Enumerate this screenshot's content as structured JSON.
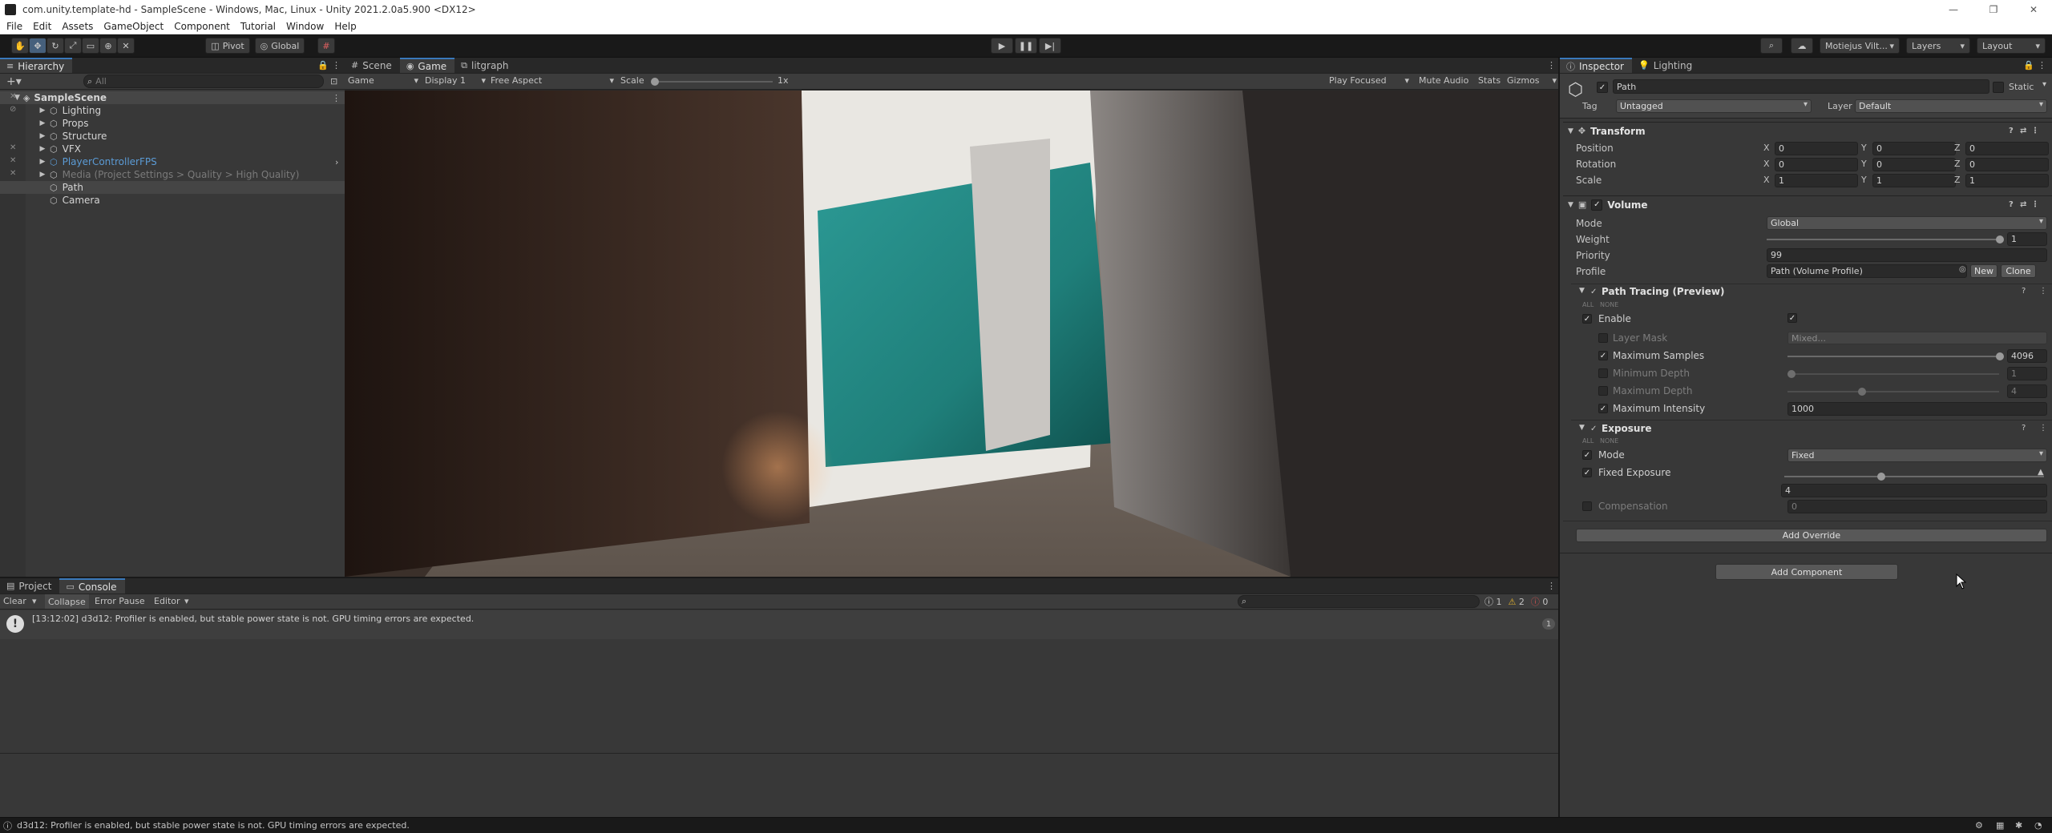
{
  "window": {
    "title": "com.unity.template-hd - SampleScene - Windows, Mac, Linux - Unity 2021.2.0a5.900 <DX12>",
    "minimize": "—",
    "maximize": "❐",
    "close": "✕"
  },
  "menu": [
    "File",
    "Edit",
    "Assets",
    "GameObject",
    "Component",
    "Tutorial",
    "Window",
    "Help"
  ],
  "toolbar": {
    "pivot": "Pivot",
    "global": "Global",
    "account": "Motiejus Vilt...",
    "layers": "Layers",
    "layout": "Layout"
  },
  "hierarchy": {
    "tab": "Hierarchy",
    "search_placeholder": "All",
    "scene": "SampleScene",
    "items": [
      {
        "label": "Lighting",
        "color": "#d4d4d4"
      },
      {
        "label": "Props",
        "color": "#d4d4d4"
      },
      {
        "label": "Structure",
        "color": "#d4d4d4"
      },
      {
        "label": "VFX",
        "color": "#d4d4d4"
      },
      {
        "label": "PlayerControllerFPS",
        "color": "#5b9bd5"
      },
      {
        "label": "Media (Project Settings > Quality > High Quality)",
        "color": "#7a7a7a"
      },
      {
        "label": "Path",
        "color": "#d4d4d4"
      },
      {
        "label": "Camera",
        "color": "#d4d4d4"
      }
    ]
  },
  "game_view": {
    "tabs": [
      "Scene",
      "Game",
      "litgraph"
    ],
    "mode": "Game",
    "display": "Display 1",
    "aspect": "Free Aspect",
    "scale_label": "Scale",
    "scale_value": "1x",
    "play_focused": "Play Focused",
    "mute_audio": "Mute Audio",
    "stats": "Stats",
    "gizmos": "Gizmos"
  },
  "console": {
    "tabs": [
      "Project",
      "Console"
    ],
    "clear": "Clear",
    "collapse": "Collapse",
    "error_pause": "Error Pause",
    "editor": "Editor",
    "count_info": "1",
    "count_warn": "2",
    "count_err": "0",
    "entry_text": "[13:12:02] d3d12: Profiler is enabled, but stable power state is not. GPU timing errors are expected.",
    "entry_count": "1",
    "status_bar": "d3d12: Profiler is enabled, but stable power state is not. GPU timing errors are expected."
  },
  "inspector": {
    "tabs": [
      "Inspector",
      "Lighting"
    ],
    "object_name": "Path",
    "static_label": "Static",
    "tag_label": "Tag",
    "tag_value": "Untagged",
    "layer_label": "Layer",
    "layer_value": "Default",
    "transform": {
      "title": "Transform",
      "rows": [
        {
          "label": "Position",
          "x": "0",
          "y": "0",
          "z": "0"
        },
        {
          "label": "Rotation",
          "x": "0",
          "y": "0",
          "z": "0"
        },
        {
          "label": "Scale",
          "x": "1",
          "y": "1",
          "z": "1"
        }
      ],
      "axis_x": "X",
      "axis_y": "Y",
      "axis_z": "Z"
    },
    "volume": {
      "title": "Volume",
      "mode_label": "Mode",
      "mode_value": "Global",
      "weight_label": "Weight",
      "weight_value": "1",
      "priority_label": "Priority",
      "priority_value": "99",
      "profile_label": "Profile",
      "profile_value": "Path (Volume Profile)",
      "new_btn": "New",
      "clone_btn": "Clone"
    },
    "path_tracing": {
      "title": "Path Tracing (Preview)",
      "all": "ALL",
      "none": "NONE",
      "enable": "Enable",
      "layer_mask": "Layer Mask",
      "layer_mask_value": "Mixed...",
      "max_samples": "Maximum Samples",
      "max_samples_value": "4096",
      "min_depth": "Minimum Depth",
      "min_depth_value": "1",
      "max_depth": "Maximum Depth",
      "max_depth_value": "4",
      "max_intensity": "Maximum Intensity",
      "max_intensity_value": "1000"
    },
    "exposure": {
      "title": "Exposure",
      "all": "ALL",
      "none": "NONE",
      "mode_label": "Mode",
      "mode_value": "Fixed",
      "fixed_label": "Fixed Exposure",
      "fixed_value": "4",
      "compensation_label": "Compensation",
      "compensation_value": "0"
    },
    "add_override": "Add Override",
    "add_component": "Add Component"
  }
}
